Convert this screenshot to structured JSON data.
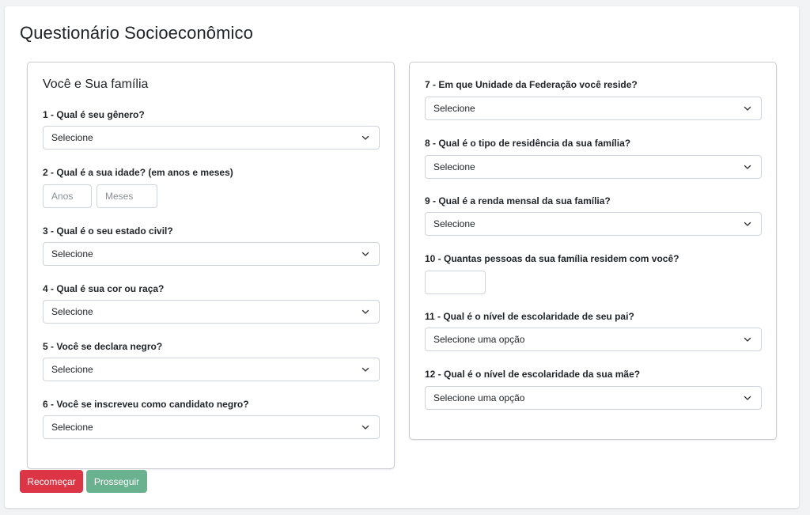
{
  "page": {
    "title": "Questionário Socioeconômico"
  },
  "left": {
    "section_title": "Você e Sua família",
    "q1": {
      "label": "1 - Qual é seu gênero?",
      "value": "Selecione"
    },
    "q2": {
      "label": "2 - Qual é a sua idade? (em anos e meses)",
      "years_placeholder": "Anos",
      "months_placeholder": "Meses"
    },
    "q3": {
      "label": "3 - Qual é o seu estado civil?",
      "value": "Selecione"
    },
    "q4": {
      "label": "4 - Qual é sua cor ou raça?",
      "value": "Selecione"
    },
    "q5": {
      "label": "5 - Você se declara negro?",
      "value": "Selecione"
    },
    "q6": {
      "label": "6 - Você se inscreveu como candidato negro?",
      "value": "Selecione"
    }
  },
  "right": {
    "q7": {
      "label": "7 - Em que Unidade da Federação você reside?",
      "value": "Selecione"
    },
    "q8": {
      "label": "8 - Qual é o tipo de residência da sua família?",
      "value": "Selecione"
    },
    "q9": {
      "label": "9 - Qual é a renda mensal da sua família?",
      "value": "Selecione"
    },
    "q10": {
      "label": "10 - Quantas pessoas da sua família residem com você?",
      "value": ""
    },
    "q11": {
      "label": "11 - Qual é o nível de escolaridade de seu pai?",
      "value": "Selecione uma opção"
    },
    "q12": {
      "label": "12 - Qual é o nível de escolaridade da sua mãe?",
      "value": "Selecione uma opção"
    }
  },
  "buttons": {
    "restart": "Recomeçar",
    "next": "Prosseguir"
  },
  "colors": {
    "danger": "#dc3545",
    "success_muted": "#6ab190"
  },
  "icons": {
    "dropdown": "chevron-down-icon"
  }
}
